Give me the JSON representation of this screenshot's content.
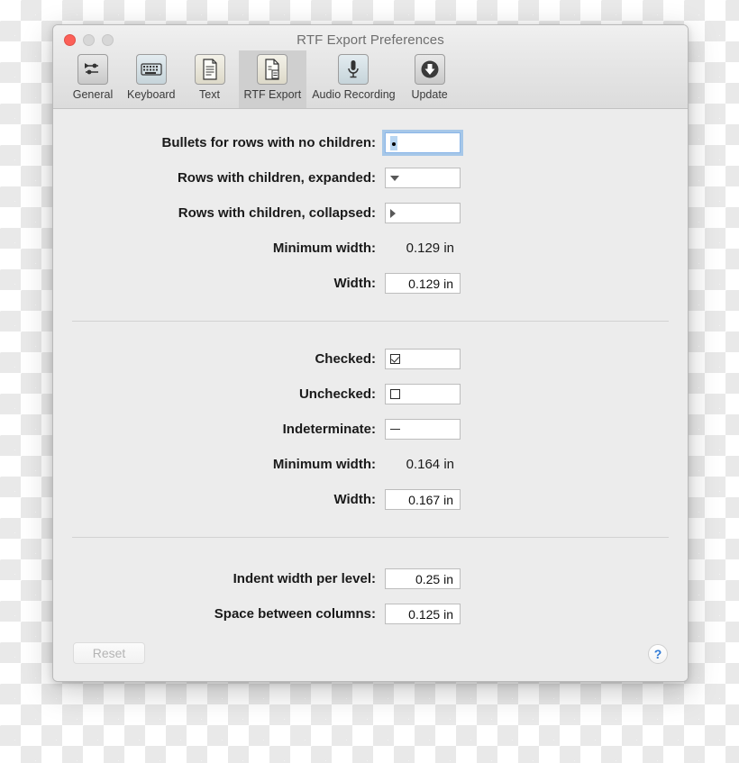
{
  "window": {
    "title": "RTF Export Preferences",
    "controls": {
      "close": "close",
      "minimize": "minimize",
      "maximize": "maximize"
    }
  },
  "toolbar": {
    "items": [
      {
        "label": "General",
        "icon": "sliders-icon",
        "selected": false
      },
      {
        "label": "Keyboard",
        "icon": "keyboard-icon",
        "selected": false
      },
      {
        "label": "Text",
        "icon": "document-icon",
        "selected": false
      },
      {
        "label": "RTF Export",
        "icon": "rtf-document-icon",
        "selected": true
      },
      {
        "label": "Audio Recording",
        "icon": "microphone-icon",
        "selected": false
      },
      {
        "label": "Update",
        "icon": "download-arrow-icon",
        "selected": false
      }
    ]
  },
  "sections": [
    {
      "rows": [
        {
          "label": "Bullets for rows with no children:",
          "type": "glyph",
          "glyph": "bullet-dot",
          "focused": true
        },
        {
          "label": "Rows with children, expanded:",
          "type": "glyph",
          "glyph": "arrow-down",
          "focused": false
        },
        {
          "label": "Rows with children, collapsed:",
          "type": "glyph",
          "glyph": "arrow-right",
          "focused": false
        },
        {
          "label": "Minimum width:",
          "type": "static",
          "value": "0.129 in"
        },
        {
          "label": "Width:",
          "type": "number",
          "value": "0.129 in"
        }
      ]
    },
    {
      "rows": [
        {
          "label": "Checked:",
          "type": "glyph",
          "glyph": "checkbox-checked",
          "focused": false
        },
        {
          "label": "Unchecked:",
          "type": "glyph",
          "glyph": "checkbox-empty",
          "focused": false
        },
        {
          "label": "Indeterminate:",
          "type": "glyph",
          "glyph": "dash",
          "focused": false
        },
        {
          "label": "Minimum width:",
          "type": "static",
          "value": "0.164 in"
        },
        {
          "label": "Width:",
          "type": "number",
          "value": "0.167 in"
        }
      ]
    },
    {
      "rows": [
        {
          "label": "Indent width per level:",
          "type": "number",
          "value": "0.25 in"
        },
        {
          "label": "Space between columns:",
          "type": "number",
          "value": "0.125 in"
        }
      ]
    }
  ],
  "footer": {
    "reset_label": "Reset",
    "reset_enabled": false,
    "help_label": "?"
  },
  "colors": {
    "accent_blue": "#2f7ad6",
    "focus_ring": "#6eaae6",
    "close_red": "#fc6058",
    "window_bg": "#ececec",
    "toolbar_selected": "#cfcfcf"
  }
}
